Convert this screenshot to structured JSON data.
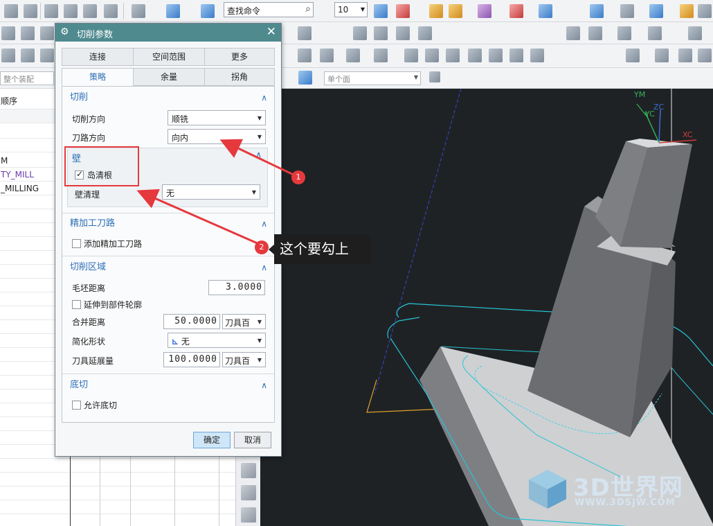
{
  "toolbar": {
    "command_search_placeholder": "查找命令",
    "selection_count": "10"
  },
  "selection_bar": {
    "scope_filter": "整个装配",
    "face_rule": "单个面"
  },
  "navigator": {
    "header": "顺序",
    "rows": [
      "M",
      "TY_MILL",
      "_MILLING"
    ]
  },
  "dialog": {
    "title": "切削参数",
    "tabs_row1": [
      "连接",
      "空间范围",
      "更多"
    ],
    "tabs_row2": [
      "策略",
      "余量",
      "拐角"
    ],
    "sections": {
      "cut": {
        "title": "切削",
        "cut_direction_label": "切削方向",
        "cut_direction_value": "顺铣",
        "pattern_direction_label": "刀路方向",
        "pattern_direction_value": "向内"
      },
      "wall": {
        "title": "壁",
        "island_cleanup_label": "岛清根",
        "island_cleanup_checked": true,
        "wall_cleanup_label": "壁清理",
        "wall_cleanup_value": "无"
      },
      "finish": {
        "title": "精加工刀路",
        "add_finish_label": "添加精加工刀路",
        "add_finish_checked": false
      },
      "cut_region": {
        "title": "切削区域",
        "blank_distance_label": "毛坯距离",
        "blank_distance_value": "3.0000",
        "extend_to_part_label": "延伸到部件轮廓",
        "extend_to_part_checked": false,
        "merge_distance_label": "合并距离",
        "merge_distance_value": "50.0000",
        "merge_distance_unit": "刀具百",
        "simplify_shape_label": "简化形状",
        "simplify_shape_value": "无",
        "tool_extension_label": "刀具延展量",
        "tool_extension_value": "100.0000",
        "tool_extension_unit": "刀具百"
      },
      "undercut": {
        "title": "底切",
        "allow_undercut_label": "允许底切",
        "allow_undercut_checked": false
      }
    },
    "ok_label": "确定",
    "cancel_label": "取消"
  },
  "viewport": {
    "axis_labels": [
      "YM",
      "ZC",
      "YC",
      "XC"
    ]
  },
  "annotations": {
    "badge_1": "1",
    "badge_2": "2",
    "callout_text": "这个要勾上"
  },
  "watermark": {
    "title": "3D世界网",
    "url": "WWW.3DSJW.COM"
  },
  "colors": {
    "dialog_title_bar": "#4f8a8f",
    "section_title": "#2c6fb6",
    "annotation_red": "#e5393d",
    "toolpath_cyan": "#27c4d6",
    "viewport_bg": "#1f2224"
  }
}
